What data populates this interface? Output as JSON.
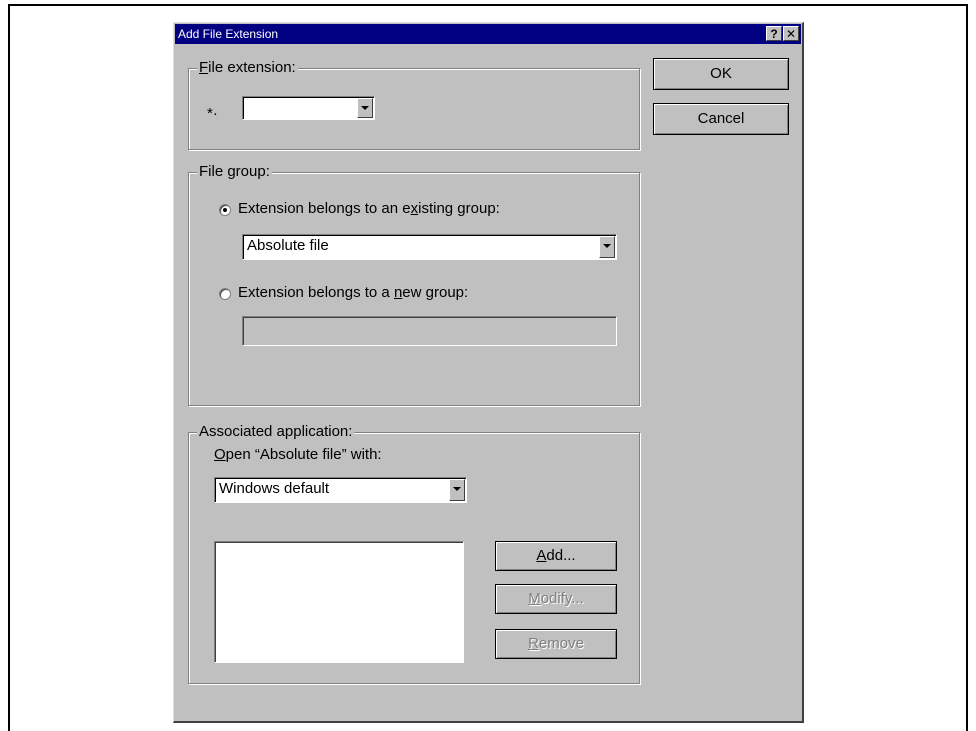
{
  "dialog": {
    "title": "Add File Extension",
    "help_glyph": "?",
    "close_glyph": "✕"
  },
  "file_extension": {
    "legend_mnemonic": "F",
    "legend_rest": "ile extension:",
    "prefix": "*·",
    "value": ""
  },
  "file_group": {
    "legend": "File group:",
    "existing": {
      "label_before": "Extension belongs to an e",
      "mnemonic": "x",
      "label_after": "isting group:",
      "checked": true,
      "selected": "Absolute file"
    },
    "new": {
      "label_before": "Extension belongs to a ",
      "mnemonic": "n",
      "label_after": "ew group:",
      "checked": false,
      "value": ""
    }
  },
  "associated_application": {
    "legend": "Associated application:",
    "open_mnemonic": "O",
    "open_rest": "pen “Absolute file” with:",
    "selected": "Windows default",
    "list_items": [],
    "add_mnemonic": "A",
    "add_rest": "dd...",
    "modify_mnemonic": "M",
    "modify_rest": "odify...",
    "remove_mnemonic": "R",
    "remove_rest": "emove"
  },
  "buttons": {
    "ok": "OK",
    "cancel": "Cancel"
  },
  "colors": {
    "titlebar": "#000080",
    "dialog_face": "#c0c0c0",
    "disabled_text": "#808080"
  }
}
